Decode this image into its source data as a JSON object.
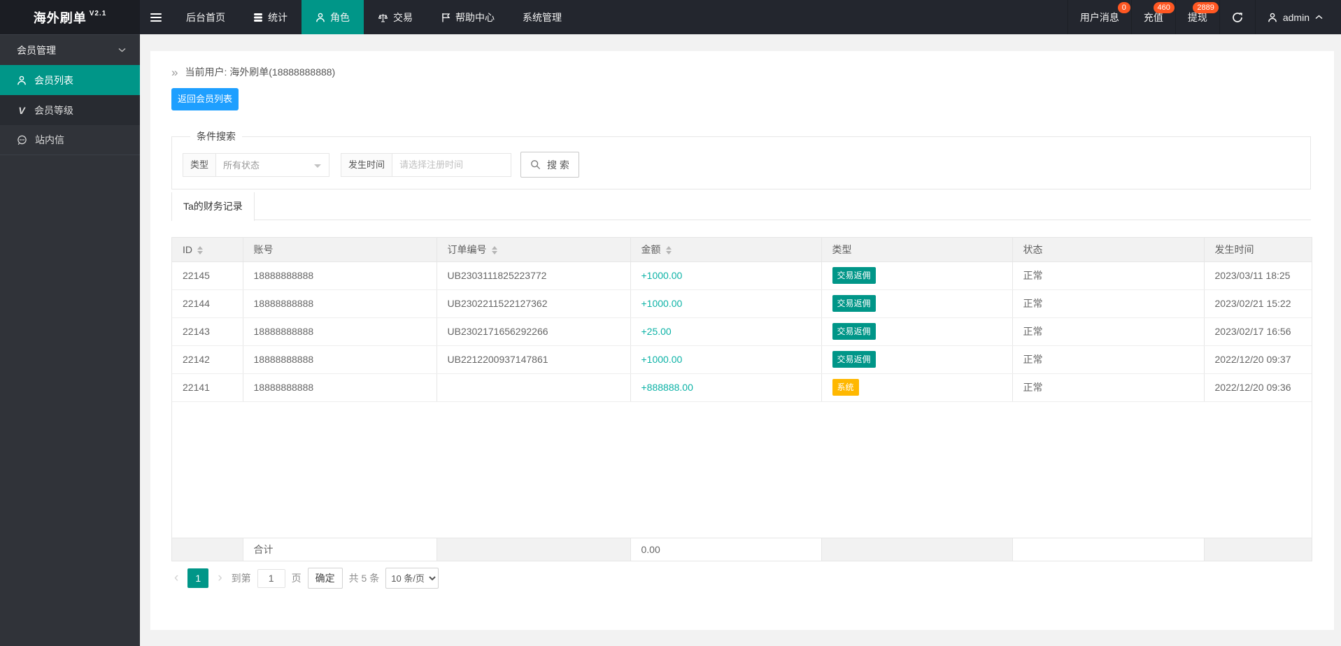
{
  "brand": {
    "name": "海外刷单",
    "version": "V2.1"
  },
  "navbar": {
    "menu": [
      {
        "label": "后台首页"
      },
      {
        "label": "统计"
      },
      {
        "label": "角色",
        "active": true
      },
      {
        "label": "交易"
      },
      {
        "label": "帮助中心"
      },
      {
        "label": "系统管理"
      }
    ],
    "notices": [
      {
        "label": "用户消息",
        "badge": "0"
      },
      {
        "label": "充值",
        "badge": "460"
      },
      {
        "label": "提现",
        "badge": "2889"
      }
    ],
    "user": "admin"
  },
  "sidebar": {
    "group": "会员管理",
    "items": [
      {
        "label": "会员列表",
        "active": true
      },
      {
        "label": "会员等级"
      },
      {
        "label": "站内信"
      }
    ]
  },
  "icons": {
    "breadcrumb_arrow": "»",
    "member_level_glyph": "V",
    "prev_arrow": "‹",
    "next_arrow": "›"
  },
  "breadcrumb": {
    "text": "当前用户: 海外刷单(18888888888)"
  },
  "toolbar": {
    "back_label": "返回会员列表"
  },
  "search": {
    "legend": "条件搜索",
    "type_label": "类型",
    "type_value": "所有状态",
    "time_label": "发生时间",
    "time_placeholder": "请选择注册时间",
    "button": "搜 索"
  },
  "tab": {
    "label": "Ta的财务记录"
  },
  "table": {
    "columns": [
      "ID",
      "账号",
      "订单编号",
      "金额",
      "类型",
      "状态",
      "发生时间"
    ],
    "rows": [
      {
        "id": "22145",
        "account": "18888888888",
        "order_no": "UB2303111825223772",
        "amount": "+1000.00",
        "type": "交易返佣",
        "status": "正常",
        "time": "2023/03/11 18:25"
      },
      {
        "id": "22144",
        "account": "18888888888",
        "order_no": "UB2302211522127362",
        "amount": "+1000.00",
        "type": "交易返佣",
        "status": "正常",
        "time": "2023/02/21 15:22"
      },
      {
        "id": "22143",
        "account": "18888888888",
        "order_no": "UB2302171656292266",
        "amount": "+25.00",
        "type": "交易返佣",
        "status": "正常",
        "time": "2023/02/17 16:56"
      },
      {
        "id": "22142",
        "account": "18888888888",
        "order_no": "UB2212200937147861",
        "amount": "+1000.00",
        "type": "交易返佣",
        "status": "正常",
        "time": "2022/12/20 09:37"
      },
      {
        "id": "22141",
        "account": "18888888888",
        "order_no": "",
        "amount": "+888888.00",
        "type": "系统",
        "status": "正常",
        "time": "2022/12/20 09:36"
      }
    ],
    "totals": {
      "label": "合计",
      "amount": "0.00"
    }
  },
  "pagination": {
    "page": "1",
    "goto_label": "到第",
    "goto_value": "1",
    "goto_unit": "页",
    "confirm": "确定",
    "total": "共 5 条",
    "size": "10 条/页"
  },
  "colors": {
    "accent_green": "#009688",
    "primary_blue": "#1E9FFF",
    "badge_red": "#FF5722",
    "type_yellow": "#FFB800",
    "amount_teal": "#0CB2A6",
    "navbar_dark": "#23262E",
    "sidebar_dark": "#303339"
  }
}
